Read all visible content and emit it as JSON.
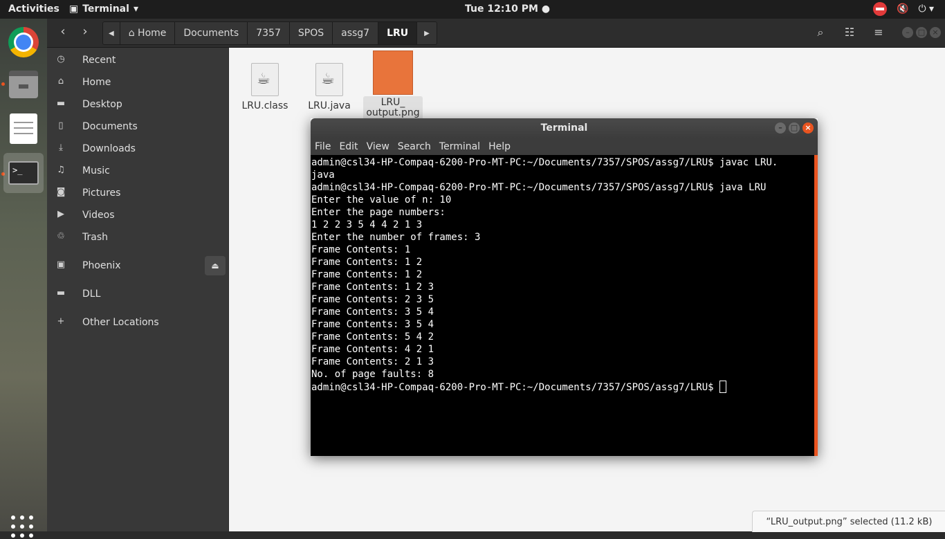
{
  "topbar": {
    "activities": "Activities",
    "app_menu": "Terminal",
    "clock": "Tue 12:10 PM"
  },
  "dock": {
    "items": [
      "chrome-icon",
      "files-icon",
      "text-editor-icon",
      "terminal-icon"
    ]
  },
  "nautilus": {
    "breadcrumb": [
      "Home",
      "Documents",
      "7357",
      "SPOS",
      "assg7",
      "LRU"
    ],
    "sidebar": [
      {
        "label": "Recent",
        "icon": "clock-icon"
      },
      {
        "label": "Home",
        "icon": "home-icon"
      },
      {
        "label": "Desktop",
        "icon": "folder-icon"
      },
      {
        "label": "Documents",
        "icon": "document-icon"
      },
      {
        "label": "Downloads",
        "icon": "download-icon"
      },
      {
        "label": "Music",
        "icon": "music-icon"
      },
      {
        "label": "Pictures",
        "icon": "camera-icon"
      },
      {
        "label": "Videos",
        "icon": "video-icon"
      },
      {
        "label": "Trash",
        "icon": "trash-icon"
      },
      {
        "label": "Phoenix",
        "icon": "drive-icon"
      },
      {
        "label": "DLL",
        "icon": "folder-icon"
      },
      {
        "label": "Other Locations",
        "icon": "plus-icon"
      }
    ],
    "files": [
      {
        "name": "LRU.class"
      },
      {
        "name": "LRU.java"
      },
      {
        "name": "LRU_\noutput.png",
        "selected": true
      }
    ],
    "status": "“LRU_output.png” selected  (11.2 kB)"
  },
  "terminal": {
    "title": "Terminal",
    "menu": [
      "File",
      "Edit",
      "View",
      "Search",
      "Terminal",
      "Help"
    ],
    "lines": [
      "admin@csl34-HP-Compaq-6200-Pro-MT-PC:~/Documents/7357/SPOS/assg7/LRU$ javac LRU.",
      "java",
      "admin@csl34-HP-Compaq-6200-Pro-MT-PC:~/Documents/7357/SPOS/assg7/LRU$ java LRU",
      "Enter the value of n: 10",
      "Enter the page numbers:",
      "1 2 2 3 5 4 4 2 1 3",
      "Enter the number of frames: 3",
      "Frame Contents: 1",
      "Frame Contents: 1 2",
      "Frame Contents: 1 2",
      "Frame Contents: 1 2 3",
      "Frame Contents: 2 3 5",
      "Frame Contents: 3 5 4",
      "Frame Contents: 3 5 4",
      "Frame Contents: 5 4 2",
      "Frame Contents: 4 2 1",
      "Frame Contents: 2 1 3",
      "No. of page faults: 8"
    ],
    "prompt": "admin@csl34-HP-Compaq-6200-Pro-MT-PC:~/Documents/7357/SPOS/assg7/LRU$ "
  }
}
